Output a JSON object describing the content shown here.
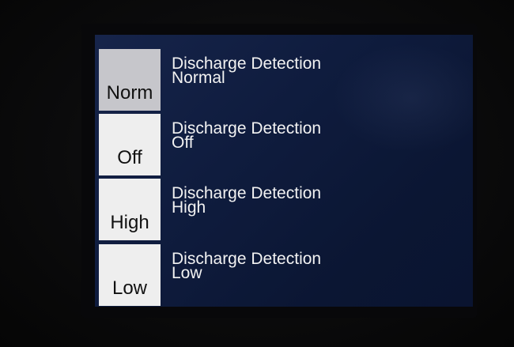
{
  "menu": {
    "items": [
      {
        "button_label": "Norm",
        "title": "Discharge Detection",
        "value": "Normal",
        "selected": true
      },
      {
        "button_label": "Off",
        "title": "Discharge Detection",
        "value": "Off",
        "selected": false
      },
      {
        "button_label": "High",
        "title": "Discharge Detection",
        "value": "High",
        "selected": false
      },
      {
        "button_label": "Low",
        "title": "Discharge Detection",
        "value": "Low",
        "selected": false
      }
    ]
  },
  "colors": {
    "screen_background": "#0f1c3e",
    "button_background": "#eeeeee",
    "selected_button_background": "#c6c6cb",
    "text_light": "#f2f2f2",
    "text_dark": "#111111"
  }
}
